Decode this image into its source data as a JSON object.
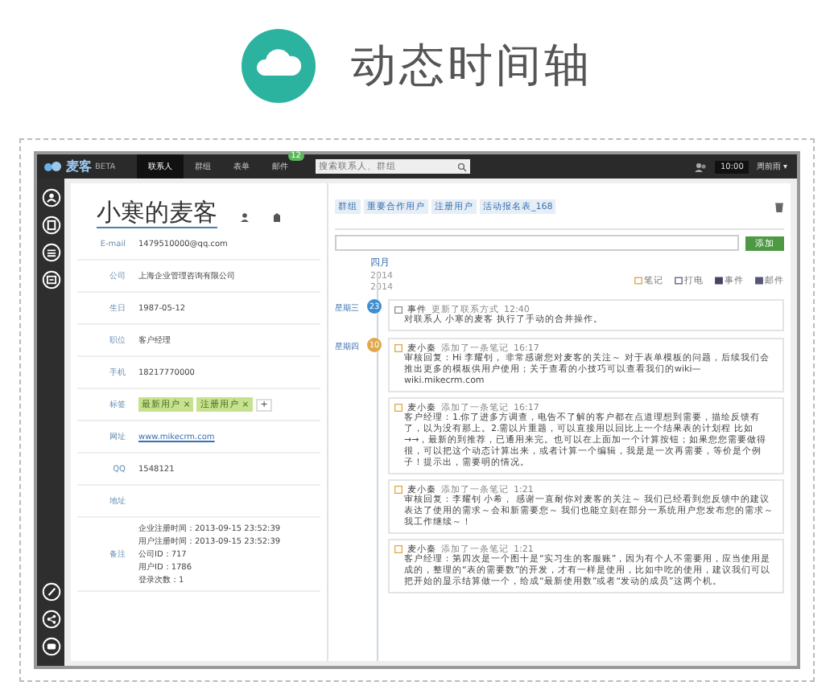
{
  "header": {
    "title": "动态时间轴"
  },
  "nav": {
    "logo": "麦客",
    "logo_badge": "BETA",
    "tabs": [
      {
        "label": "联系人",
        "selected": true
      },
      {
        "label": "群组",
        "selected": false
      },
      {
        "label": "表单",
        "selected": false
      },
      {
        "label": "邮件",
        "selected": false,
        "badge": "12"
      }
    ],
    "search": {
      "placeholder": "搜索联系人、群组"
    },
    "clock": "10:00",
    "user": "周前雨",
    "user_caret": "▾"
  },
  "contact": {
    "name": "小寒的麦客",
    "fields": [
      {
        "label": "E-mail",
        "kind": "text",
        "value": "1479510000@qq.com"
      },
      {
        "label": "公司",
        "kind": "text",
        "value": "上海企业管理咨询有限公司"
      },
      {
        "label": "生日",
        "kind": "text",
        "value": "1987-05-12"
      },
      {
        "label": "职位",
        "kind": "text",
        "value": "客户经理"
      },
      {
        "label": "手机",
        "kind": "text",
        "value": "18217770000"
      },
      {
        "label": "标签",
        "kind": "tags",
        "tags": [
          "最新用户",
          "注册用户"
        ],
        "remove": "×",
        "add": "+"
      },
      {
        "label": "网址",
        "kind": "link",
        "value": "www.mikecrm.com"
      },
      {
        "label": "QQ",
        "kind": "text",
        "value": "1548121"
      },
      {
        "label": "地址",
        "kind": "text"
      },
      {
        "label": "备注",
        "kind": "lines",
        "lines": [
          "企业注册时间：2013-09-15 23:52:39",
          "用户注册时间：2013-09-15 23:52:39",
          "公司ID：717",
          "用户ID：1786",
          "登录次数：1"
        ]
      }
    ]
  },
  "groups": [
    "群组",
    "重要合作用户",
    "注册用户",
    "活动报名表_168"
  ],
  "note_input": {
    "button": "添加"
  },
  "timeline": {
    "month": "四月",
    "years": [
      "2014",
      "2014"
    ],
    "actions": [
      "笔记",
      "打电",
      "事件",
      "邮件"
    ],
    "days": [
      {
        "day": "23",
        "weekday": "星期三",
        "color": "#3d8fd1",
        "entries": [
          {
            "kind": "event",
            "author": "事件",
            "action": "更新了联系方式",
            "time": "12:40",
            "text": "对联系人 小寒的麦客 执行了手动的合并操作。"
          }
        ]
      },
      {
        "day": "10",
        "weekday": "星期四",
        "color": "#e0a84a",
        "entries": [
          {
            "kind": "note",
            "author": "麦小秦",
            "action": "添加了一条笔记",
            "time": "16:17",
            "text": "审核回复：Hi 李耀钊， 非常感谢您对麦客的关注～ 对于表单模板的问题，后续我们会推出更多的模板供用户使用；关于查看的小技巧可以查看我们的wiki—wiki.mikecrm.com"
          },
          {
            "kind": "note",
            "author": "麦小秦",
            "action": "添加了一条笔记",
            "time": "16:17",
            "text": "客户经理：1.你了进多方调查，电告不了解的客户都在点道理想到需要，描绘反馈有了，以为没有那上。2.需以片重题，可以直接用以回比上一个结果表的计划程 比如→→，最新的到推荐，已通用来完。也可以在上面加一个计算按钮；如果您您需要做得很，可以把这个动态计算出来，或者计算一个编辑，我是是一次再需要，等价是个例子！提示出，需要明的情况。"
          },
          {
            "kind": "note",
            "author": "麦小秦",
            "action": "添加了一条笔记",
            "time": "1:21",
            "text": "审核回复：李耀钊 小希， 感谢一直耐你对麦客的关注～ 我们已经看到您反馈中的建议表达了使用的需求～会和新需要您～ 我们也能立刻在部分一系统用户您发布您的需求～我工作继续～！"
          },
          {
            "kind": "note",
            "author": "麦小秦",
            "action": "添加了一条笔记",
            "time": "1:21",
            "text": "客户经理：第四次是一个图十是“实习生的客服账”，因为有个人不需要用，应当使用是成的，整理的“表的需要数”的开发，才有一样是使用，比如中吃的使用，建议我们可以把开始的显示结算做一个，给成“最新使用数”或者“发动的成员”这两个机。"
          }
        ]
      }
    ]
  }
}
